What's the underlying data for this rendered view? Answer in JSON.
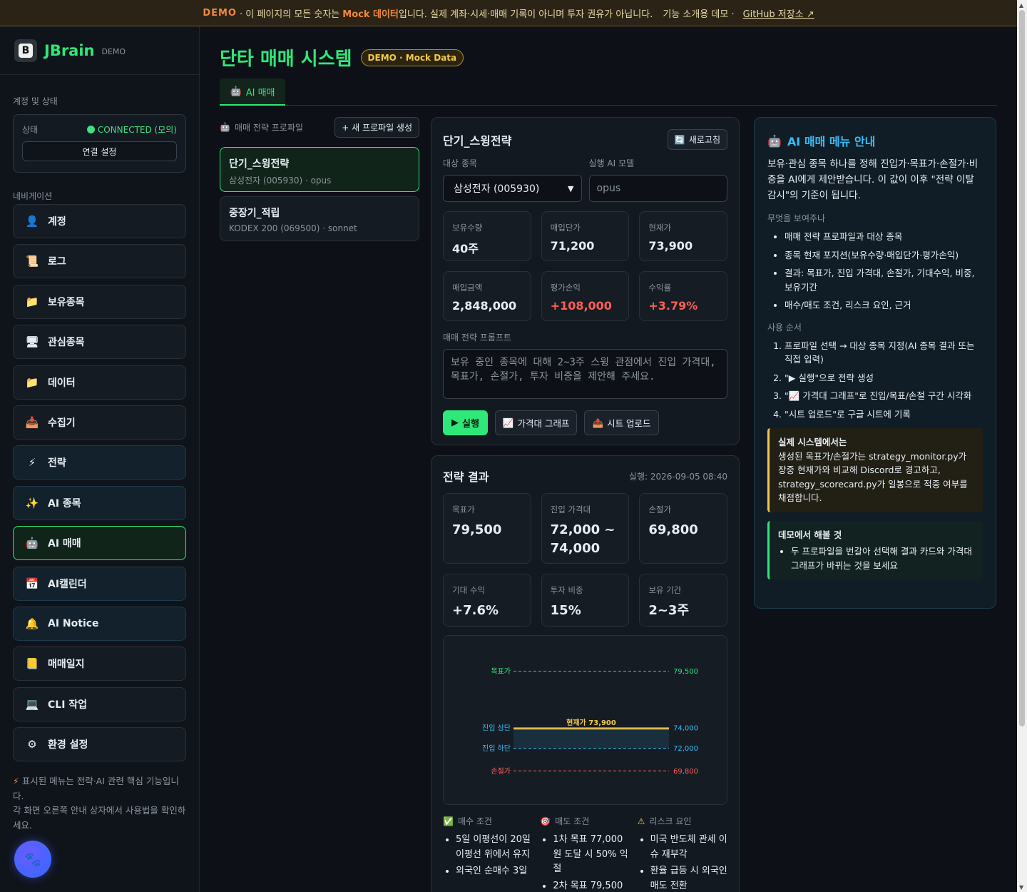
{
  "banner": {
    "demo": "DEMO",
    "text1": "· 이 페이지의 모든 숫자는",
    "mock": "Mock 데이터",
    "text2": "입니다. 실제 계좌·시세·매매 기록이 아니며 투자 권유가 아닙니다.",
    "text3": "기능 소개용 데모 ·",
    "link": "GitHub 저장소 ↗"
  },
  "brand": {
    "logo": "B",
    "name": "JBrain",
    "tag": "DEMO"
  },
  "account": {
    "section": "계정 및 상태",
    "status_label": "상태",
    "status_value": "CONNECTED (모의)",
    "button": "연결 설정"
  },
  "nav": {
    "section": "네비게이션",
    "items": [
      {
        "icon": "👤",
        "label": "계정"
      },
      {
        "icon": "📜",
        "label": "로그"
      },
      {
        "icon": "📁",
        "label": "보유종목"
      },
      {
        "icon": "🖥",
        "label": "관심종목"
      },
      {
        "icon": "📁",
        "label": "데이터"
      },
      {
        "icon": "📥",
        "label": "수집기"
      },
      {
        "icon": "⚡",
        "label": "전략"
      },
      {
        "icon": "✨",
        "label": "AI 종목"
      },
      {
        "icon": "🤖",
        "label": "AI 매매"
      },
      {
        "icon": "📅",
        "label": "AI캘린더"
      },
      {
        "icon": "🔔",
        "label": "AI Notice"
      },
      {
        "icon": "📒",
        "label": "매매일지"
      },
      {
        "icon": "💻",
        "label": "CLI 작업"
      },
      {
        "icon": "⚙",
        "label": "환경 설정"
      }
    ]
  },
  "side_note": {
    "icon": "⚡",
    "line1": "표시된 메뉴는 전략·AI 관련 핵심 기능입니다.",
    "line2": "각 화면 오른쪽 안내 상자에서 사용법을 확인하세요."
  },
  "fab_icon": "🐾",
  "header": {
    "title": "단타 매매 시스템",
    "badge": "DEMO · Mock Data"
  },
  "tabs": [
    {
      "icon": "🤖",
      "label": "AI 매매"
    }
  ],
  "profiles": {
    "label": "매매 전략 프로파일",
    "icon": "🤖",
    "new_button": "+ 새 프로파일 생성",
    "items": [
      {
        "name": "단기_스윙전략",
        "sub": "삼성전자 (005930) · opus"
      },
      {
        "name": "중장기_적립",
        "sub": "KODEX 200 (069500) · sonnet"
      }
    ]
  },
  "strategy": {
    "title": "단기_스윙전략",
    "refresh": "새로고침",
    "refresh_icon": "🔄",
    "target_label": "대상 종목",
    "target_value": "삼성전자 (005930)",
    "model_label": "실행 AI 모델",
    "model_value": "opus",
    "stats": [
      {
        "label": "보유수량",
        "value": "40주"
      },
      {
        "label": "매입단가",
        "value": "71,200"
      },
      {
        "label": "현재가",
        "value": "73,900"
      },
      {
        "label": "매입금액",
        "value": "2,848,000"
      },
      {
        "label": "평가손익",
        "value": "+108,000"
      },
      {
        "label": "수익률",
        "value": "+3.79%"
      }
    ],
    "prompt_label": "매매 전략 프롬프트",
    "prompt_text": "보유 중인 종목에 대해 2~3주 스윙 관점에서 진입 가격대, 목표가, 손절가, 투자 비중을 제안해 주세요.",
    "run": "실행",
    "run_icon": "▶",
    "chart_btn": "가격대 그래프",
    "chart_btn_icon": "📈",
    "upload_btn": "시트 업로드",
    "upload_btn_icon": "📤"
  },
  "result": {
    "title": "전략 결과",
    "time": "실행: 2026-09-05 08:40",
    "stats": [
      {
        "label": "목표가",
        "value": "79,500"
      },
      {
        "label": "진입 가격대",
        "value": "72,000 ~ 74,000"
      },
      {
        "label": "손절가",
        "value": "69,800"
      },
      {
        "label": "기대 수익",
        "value": "+7.6%"
      },
      {
        "label": "투자 비중",
        "value": "15%"
      },
      {
        "label": "보유 기간",
        "value": "2~3주"
      }
    ],
    "buy": {
      "icon": "✅",
      "title": "매수 조건",
      "items": [
        "5일 이평선이 20일 이평선 위에서 유지",
        "외국인 순매수 3일"
      ]
    },
    "sell": {
      "icon": "🎯",
      "title": "매도 조건",
      "items": [
        "1차 목표 77,000원 도달 시 50% 익절",
        "2차 목표 79,500"
      ]
    },
    "risk": {
      "icon": "⚠",
      "title": "리스크 요인",
      "items": [
        "미국 반도체 관세 이슈 재부각",
        "환율 급등 시 외국인 매도 전환"
      ]
    }
  },
  "chart_data": {
    "type": "line",
    "title": "",
    "y_unit": "원",
    "levels": [
      {
        "name": "목표가",
        "label": "목표가",
        "value": 79500,
        "value_label": "79,500",
        "color": "#2ee87a",
        "style": "dashed"
      },
      {
        "name": "진입 상단",
        "label": "진입 상단",
        "value": 74000,
        "value_label": "74,000",
        "color": "#38bdf8",
        "style": "solid"
      },
      {
        "name": "진입 하단",
        "label": "진입 하단",
        "value": 72000,
        "value_label": "72,000",
        "color": "#38bdf8",
        "style": "dashed"
      },
      {
        "name": "손절가",
        "label": "손절가",
        "value": 69800,
        "value_label": "69,800",
        "color": "#ff5f56",
        "style": "dashed"
      }
    ],
    "current": {
      "label": "현재가 73,900",
      "value": 73900,
      "color": "#f2c94c"
    },
    "ylim": [
      68500,
      81000
    ]
  },
  "guide": {
    "icon": "🤖",
    "title": "AI 매매 메뉴 안내",
    "intro": "보유·관심 종목 하나를 정해 진입가·목표가·손절가·비중을 AI에게 제안받습니다. 이 값이 이후 \"전략 이탈 감시\"의 기준이 됩니다.",
    "what_label": "무엇을 보여주나",
    "what_items": [
      "매매 전략 프로파일과 대상 종목",
      "종목 현재 포지션(보유수량·매입단가·평가손익)",
      "결과: 목표가, 진입 가격대, 손절가, 기대수익, 비중, 보유기간",
      "매수/매도 조건, 리스크 요인, 근거"
    ],
    "how_label": "사용 순서",
    "how_items": [
      "프로파일 선택 → 대상 종목 지정(AI 종목 결과 또는 직접 입력)",
      "\"▶ 실행\"으로 전략 생성",
      "\"📈 가격대 그래프\"로 진입/목표/손절 구간 시각화",
      "\"시트 업로드\"로 구글 시트에 기록"
    ],
    "real_title": "실제 시스템에서는",
    "real_text": "생성된 목표가/손절가는 strategy_monitor.py가 장중 현재가와 비교해 Discord로 경고하고, strategy_scorecard.py가 일봉으로 적중 여부를 채점합니다.",
    "try_title": "데모에서 해볼 것",
    "try_items": [
      "두 프로파일을 번갈아 선택해 결과 카드와 가격대 그래프가 바뀌는 것을 보세요"
    ]
  }
}
